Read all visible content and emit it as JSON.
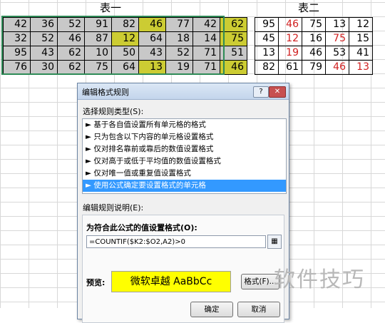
{
  "table1": {
    "title": "表一",
    "rows": [
      [
        "42",
        "36",
        "52",
        "91",
        "82",
        "46",
        "77",
        "42",
        "62"
      ],
      [
        "32",
        "52",
        "46",
        "87",
        "12",
        "64",
        "18",
        "14",
        "75"
      ],
      [
        "95",
        "43",
        "62",
        "10",
        "50",
        "43",
        "52",
        "71",
        "51"
      ],
      [
        "76",
        "30",
        "62",
        "75",
        "64",
        "13",
        "19",
        "71",
        "46"
      ]
    ],
    "highlighted_cells": [
      "r1c6",
      "r1c9",
      "r2c5",
      "r2c9",
      "r4c6",
      "r4c9"
    ],
    "highlight_color": "#cccc33"
  },
  "table2": {
    "title": "表二",
    "rows": [
      [
        "95",
        "46",
        "75",
        "13",
        "12"
      ],
      [
        "45",
        "12",
        "16",
        "75",
        "15"
      ],
      [
        "13",
        "19",
        "46",
        "53",
        "41"
      ],
      [
        "82",
        "61",
        "79",
        "46",
        "13"
      ]
    ],
    "red_cells": [
      "r1c2",
      "r2c2",
      "r2c4",
      "r3c2",
      "r4c4",
      "r4c5"
    ],
    "red_color": "#d02020"
  },
  "dialog": {
    "title": "编辑格式规则",
    "help": "?",
    "close": "✕",
    "rule_type_label": "选择规则类型(S):",
    "rules": [
      "► 基于各自值设置所有单元格的格式",
      "► 只为包含以下内容的单元格设置格式",
      "► 仅对排名靠前或靠后的数值设置格式",
      "► 仅对高于或低于平均值的数值设置格式",
      "► 仅对唯一值或重复值设置格式",
      "► 使用公式确定要设置格式的单元格"
    ],
    "selected_rule_index": 5,
    "desc_label": "编辑规则说明(E):",
    "formula_label": "为符合此公式的值设置格式(O):",
    "formula_value": "=COUNTIF($K2:$O2,A2)>0",
    "preview_label": "预览:",
    "preview_text": "微软卓越  AaBbCc",
    "preview_bg": "#ffff00",
    "format_button": "格式(F)...",
    "ok_button": "确定",
    "cancel_button": "取消"
  },
  "watermark": "软件技巧"
}
